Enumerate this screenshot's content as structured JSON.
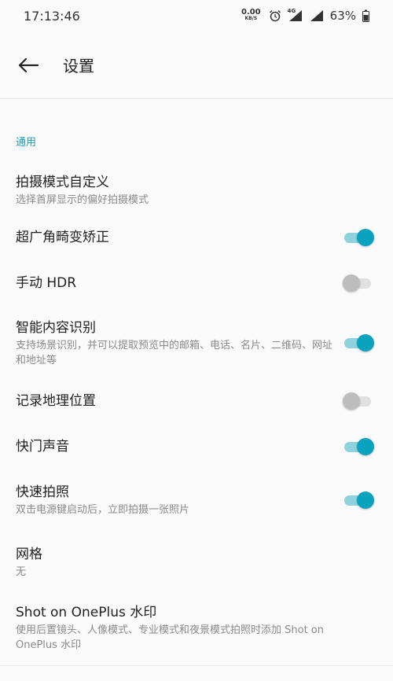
{
  "status": {
    "time": "17:13:46",
    "net_speed": "0.00",
    "net_unit": "KB/S",
    "network_type": "4G",
    "battery": "63%"
  },
  "appbar": {
    "title": "设置"
  },
  "section": {
    "header": "通用"
  },
  "settings": [
    {
      "title": "拍摄模式自定义",
      "summary": "选择首屏显示的偏好拍摄模式"
    },
    {
      "title": "超广角畸变矫正",
      "toggle": true
    },
    {
      "title": "手动 HDR",
      "toggle": false
    },
    {
      "title": "智能内容识别",
      "summary": "支持场景识别，并可以提取预览中的邮箱、电话、名片、二维码、网址和地址等",
      "toggle": true
    },
    {
      "title": "记录地理位置",
      "toggle": false
    },
    {
      "title": "快门声音",
      "toggle": true
    },
    {
      "title": "快速拍照",
      "summary": "双击电源键启动后，立即拍摄一张照片",
      "toggle": true
    },
    {
      "title": "网格",
      "summary": "无"
    },
    {
      "title": "Shot on OnePlus 水印",
      "summary": "使用后置镜头、人像模式、专业模式和夜景模式拍照时添加 Shot on OnePlus 水印"
    }
  ],
  "colors": {
    "accent": "#0aa3bf",
    "section_header": "#1a9fb5",
    "background": "#fafafa"
  }
}
